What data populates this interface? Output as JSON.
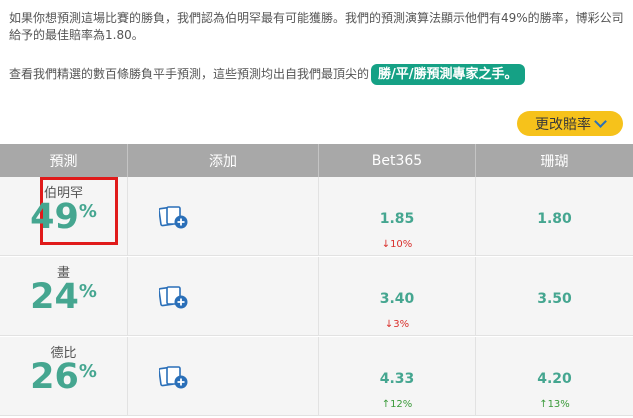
{
  "intro": {
    "paragraph1": "如果你想預測這場比賽的勝負，我們認為伯明罕最有可能獲勝。我們的預測演算法顯示他們有49%的勝率，博彩公司給予的最佳賠率為1.80。",
    "paragraph2_text": "查看我們精選的數百條勝負平手預測，這些預測均出自我們最頂尖的",
    "paragraph2_highlight": "勝/平/勝預測專家之手。"
  },
  "change_odds_button": "更改賠率",
  "table": {
    "headers": [
      "預測",
      "添加",
      "Bet365",
      "珊瑚"
    ],
    "rows": [
      {
        "team": "伯明罕",
        "pct": "49",
        "pct_symbol": "%",
        "bet365": "1.85",
        "bet365_change": "↓10%",
        "bet365_dir": "down",
        "coral": "1.80",
        "coral_change": "",
        "coral_dir": ""
      },
      {
        "team": "畫",
        "pct": "24",
        "pct_symbol": "%",
        "bet365": "3.40",
        "bet365_change": "↓3%",
        "bet365_dir": "down",
        "coral": "3.50",
        "coral_change": "",
        "coral_dir": ""
      },
      {
        "team": "德比",
        "pct": "26",
        "pct_symbol": "%",
        "bet365": "4.33",
        "bet365_change": "↑12%",
        "bet365_dir": "up",
        "coral": "4.20",
        "coral_change": "↑13%",
        "coral_dir": "up"
      }
    ]
  },
  "colors": {
    "accent_green": "#45a690",
    "highlight_bg": "#15a185",
    "button_yellow": "#f6c21b",
    "header_gray": "#a8a8a8",
    "alert_red": "#e01a1a",
    "icon_blue": "#2a6fb8"
  }
}
